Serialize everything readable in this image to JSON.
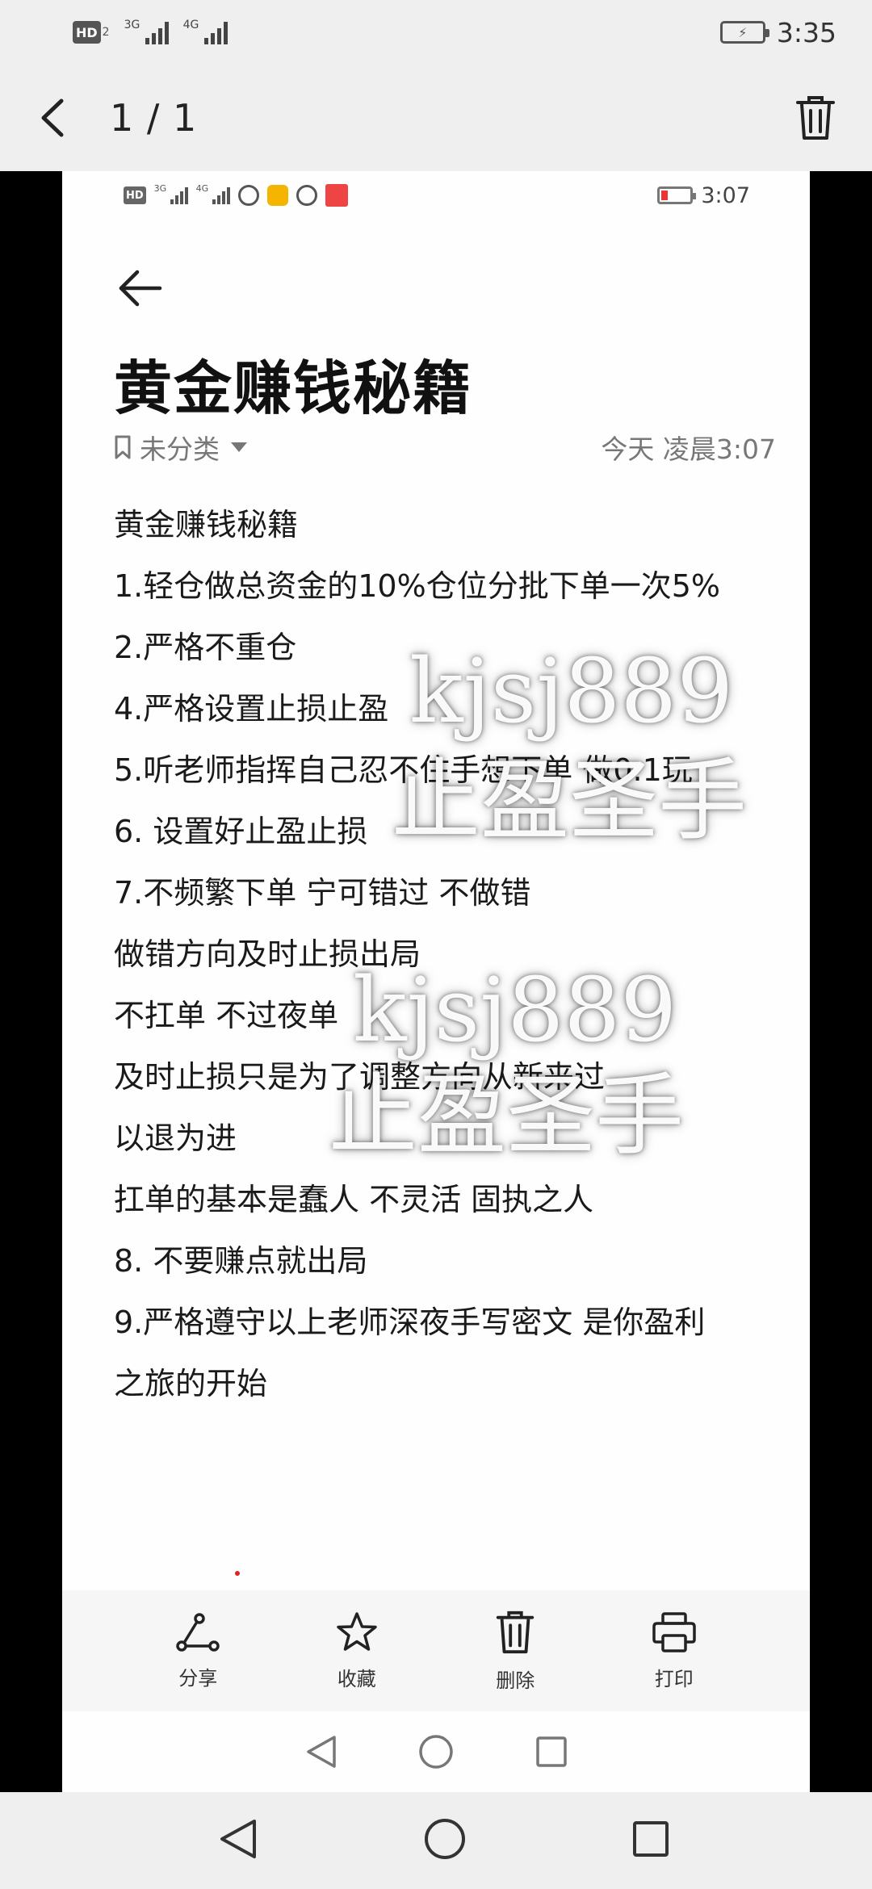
{
  "status_bar": {
    "hd_label": "HD",
    "hd_sub": "2",
    "signal1_label": "3G",
    "signal2_label": "4G",
    "time": "3:35"
  },
  "viewer": {
    "counter": "1 / 1"
  },
  "inner_status": {
    "hd_label": "HD",
    "signal1_label": "3G",
    "signal2_label": "4G",
    "time": "3:07"
  },
  "note": {
    "title": "黄金赚钱秘籍",
    "category": "未分类",
    "timestamp": "今天 凌晨3:07",
    "lines": [
      "黄金赚钱秘籍",
      "1.轻仓做总资金的10%仓位分批下单一次5%",
      "2.严格不重仓",
      "4.严格设置止损止盈",
      "5.听老师指挥自己忍不住手想下单 做0.1玩",
      "6. 设置好止盈止损",
      "7.不频繁下单 宁可错过 不做错",
      "做错方向及时止损出局",
      "不扛单 不过夜单",
      "及时止损只是为了调整方向从新来过",
      "以退为进",
      "扛单的基本是蠢人 不灵活 固执之人",
      "8. 不要赚点就出局",
      "9.严格遵守以上老师深夜手写密文 是你盈利",
      "之旅的开始"
    ]
  },
  "watermarks": {
    "id_text": "kjsj889",
    "slogan": "止盈圣手"
  },
  "actions": {
    "share": "分享",
    "favorite": "收藏",
    "delete": "删除",
    "print": "打印"
  },
  "colors": {
    "outer_bg": "#efefef",
    "note_bg": "#fefefe",
    "action_bar_bg": "#f6f6f6",
    "text": "#1a1a1a"
  }
}
